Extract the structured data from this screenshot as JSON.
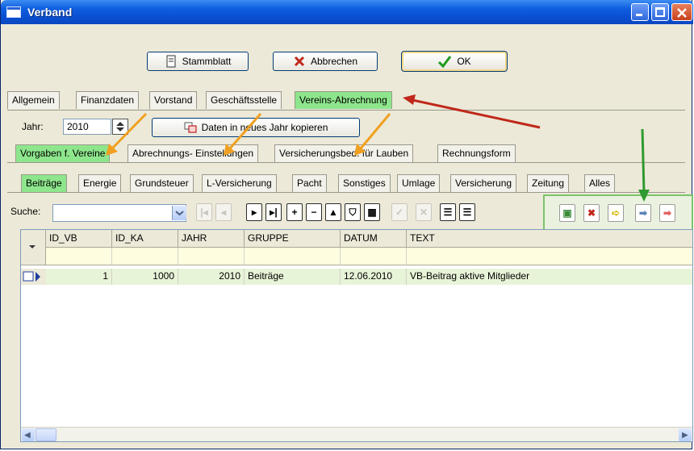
{
  "window": {
    "title": "Verband",
    "title_icon": "window-icon"
  },
  "toolbar": {
    "stammblatt_label": "Stammblatt",
    "abbrechen_label": "Abbrechen",
    "ok_label": "OK"
  },
  "main_tabs": [
    "Allgemein",
    "Finanzdaten",
    "Vorstand",
    "Geschäftsstelle",
    "Vereins-Abrechnung"
  ],
  "year": {
    "label": "Jahr:",
    "value": "2010"
  },
  "copy_button_label": "Daten in neues Jahr kopieren",
  "sub_tabs": [
    "Vorgaben f. Vereine",
    "Abrechnungs- Einstellungen",
    "Versicherungsbed. für Lauben",
    "Rechnungsform"
  ],
  "category_tabs": [
    "Beiträge",
    "Energie",
    "Grundsteuer",
    "L-Versicherung",
    "Pacht",
    "Sonstiges",
    "Umlage",
    "Versicherung",
    "Zeitung",
    "Alles"
  ],
  "search": {
    "label": "Suche:",
    "value": ""
  },
  "table": {
    "columns": [
      "ID_VB",
      "ID_KA",
      "JAHR",
      "GRUPPE",
      "DATUM",
      "TEXT"
    ],
    "rows": [
      {
        "ID_VB": "1",
        "ID_KA": "1000",
        "JAHR": "2010",
        "GRUPPE": "Beiträge",
        "DATUM": "12.06.2010",
        "TEXT": "VB-Beitrag aktive Mitglieder"
      }
    ]
  },
  "colors": {
    "active_tab": "#8ee68c",
    "titlebar": "#0a4fd1",
    "highlight_box": "#7cc36a",
    "filter_row": "#fffde0"
  }
}
